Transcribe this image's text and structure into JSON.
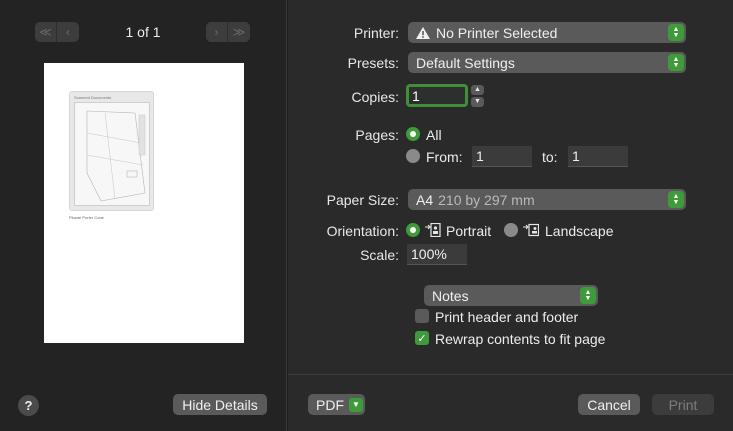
{
  "preview": {
    "page_indicator": "1 of 1",
    "nav_first_icon": "double-chevron-left-icon",
    "nav_prev_icon": "chevron-left-icon",
    "nav_next_icon": "chevron-right-icon",
    "nav_last_icon": "double-chevron-right-icon",
    "thumbnail_title": "Scanned Documents",
    "thumbnail_caption": "Pilante Porter Cone"
  },
  "left_footer": {
    "help_label": "?",
    "hide_details_label": "Hide Details"
  },
  "printer": {
    "label": "Printer:",
    "value": "No Printer Selected",
    "icon": "warning-icon"
  },
  "presets": {
    "label": "Presets:",
    "value": "Default Settings"
  },
  "copies": {
    "label": "Copies:",
    "value": "1"
  },
  "pages": {
    "label": "Pages:",
    "all_label": "All",
    "from_label": "From:",
    "from_value": "1",
    "to_label": "to:",
    "to_value": "1",
    "selected": "All"
  },
  "paper_size": {
    "label": "Paper Size:",
    "value": "A4",
    "detail": "210 by 297 mm"
  },
  "orientation": {
    "label": "Orientation:",
    "portrait_label": "Portrait",
    "landscape_label": "Landscape",
    "selected": "Portrait"
  },
  "scale": {
    "label": "Scale:",
    "value": "100%"
  },
  "section": {
    "value": "Notes"
  },
  "options": {
    "print_header_footer_label": "Print header and footer",
    "print_header_footer_checked": false,
    "rewrap_label": "Rewrap contents to fit page",
    "rewrap_checked": true
  },
  "footer": {
    "pdf_label": "PDF",
    "cancel_label": "Cancel",
    "print_label": "Print"
  },
  "colors": {
    "accent": "#3f9a3a",
    "background": "#2a2a2a",
    "control": "#5a5a5a"
  }
}
